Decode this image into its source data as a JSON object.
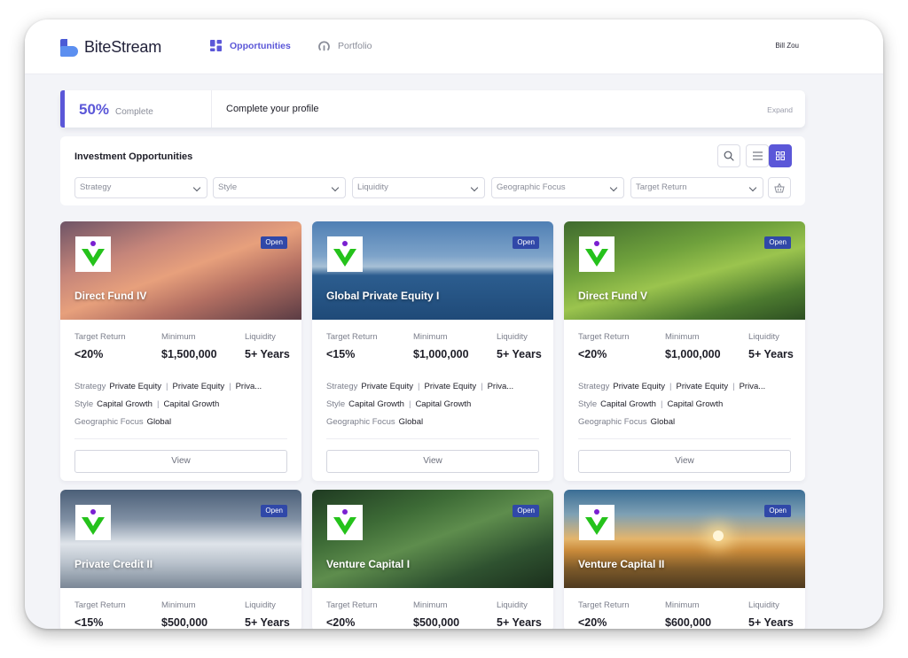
{
  "app": {
    "brand": "BiteStream",
    "user_name": "Bill Zou"
  },
  "nav": {
    "opportunities": "Opportunities",
    "portfolio": "Portfolio"
  },
  "profile": {
    "percent": "50%",
    "percent_label": "Complete",
    "title": "Complete your profile",
    "expand": "Expand"
  },
  "opportunities": {
    "title": "Investment Opportunities",
    "filters": [
      {
        "placeholder": "Strategy"
      },
      {
        "placeholder": "Style"
      },
      {
        "placeholder": "Liquidity"
      },
      {
        "placeholder": "Geographic Focus"
      },
      {
        "placeholder": "Target Return"
      }
    ],
    "labels": {
      "target_return": "Target Return",
      "minimum": "Minimum",
      "liquidity": "Liquidity",
      "strategy": "Strategy",
      "style": "Style",
      "geo": "Geographic Focus",
      "view": "View"
    },
    "cards": [
      {
        "name": "Direct Fund IV",
        "status": "Open",
        "target_return": "<20%",
        "minimum": "$1,500,000",
        "liquidity": "5+ Years",
        "strategy": [
          "Private Equity",
          "Private Equity",
          "Priva..."
        ],
        "style": [
          "Capital Growth",
          "Capital Growth"
        ],
        "geo": "Global"
      },
      {
        "name": "Global Private Equity I",
        "status": "Open",
        "target_return": "<15%",
        "minimum": "$1,000,000",
        "liquidity": "5+ Years",
        "strategy": [
          "Private Equity",
          "Private Equity",
          "Priva..."
        ],
        "style": [
          "Capital Growth",
          "Capital Growth"
        ],
        "geo": "Global"
      },
      {
        "name": "Direct Fund V",
        "status": "Open",
        "target_return": "<20%",
        "minimum": "$1,000,000",
        "liquidity": "5+ Years",
        "strategy": [
          "Private Equity",
          "Private Equity",
          "Priva..."
        ],
        "style": [
          "Capital Growth",
          "Capital Growth"
        ],
        "geo": "Global"
      },
      {
        "name": "Private Credit II",
        "status": "Open",
        "target_return": "<15%",
        "minimum": "$500,000",
        "liquidity": "5+ Years"
      },
      {
        "name": "Venture Capital I",
        "status": "Open",
        "target_return": "<20%",
        "minimum": "$500,000",
        "liquidity": "5+ Years"
      },
      {
        "name": "Venture Capital II",
        "status": "Open",
        "target_return": "<20%",
        "minimum": "$600,000",
        "liquidity": "5+ Years"
      }
    ]
  },
  "colors": {
    "accent": "#5b57d8",
    "badge": "#3048a8",
    "logo_green": "#25c21b",
    "logo_dot": "#7a1fd1"
  }
}
